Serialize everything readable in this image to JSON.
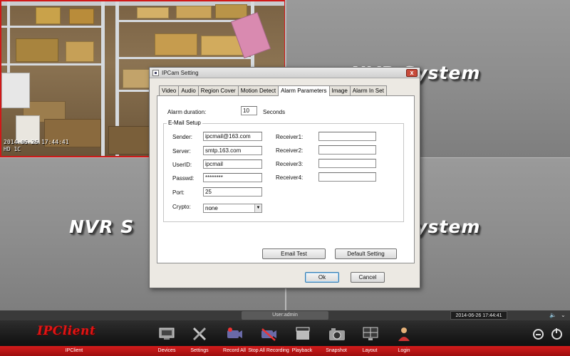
{
  "video": {
    "cam1_timestamp": "2014-06-26 17:44:41",
    "cam1_channel": "HD 1C",
    "watermark": "NVR System",
    "watermark_partial": "NVR S"
  },
  "dialog": {
    "title": "IPCam Setting",
    "close_label": "x",
    "tabs": [
      "Video",
      "Audio",
      "Region Cover",
      "Motion Detect",
      "Alarm Parameters",
      "Image",
      "Alarm In Set"
    ],
    "active_tab": "Alarm Parameters",
    "alarm_duration_label": "Alarm duration:",
    "alarm_duration_value": "10",
    "alarm_duration_unit": "Seconds",
    "email_group_title": "E-Mail Setup",
    "sender_label": "Sender:",
    "sender_value": "ipcmail@163.com",
    "server_label": "Server:",
    "server_value": "smtp.163.com",
    "userid_label": "UserID:",
    "userid_value": "ipcmail",
    "passwd_label": "Passwd:",
    "passwd_value": "********",
    "port_label": "Port:",
    "port_value": "25",
    "crypto_label": "Crypto:",
    "crypto_value": "none",
    "receiver1_label": "Receiver1:",
    "receiver1_value": "",
    "receiver2_label": "Receiver2:",
    "receiver2_value": "",
    "receiver3_label": "Receiver3:",
    "receiver3_value": "",
    "receiver4_label": "Receiver4:",
    "receiver4_value": "",
    "email_test_label": "Email Test",
    "default_setting_label": "Default Setting",
    "ok_label": "Ok",
    "cancel_label": "Cancel"
  },
  "status": {
    "user": "User:admin",
    "clock": "2014-06-26 17:44:41"
  },
  "taskbar": {
    "brand": "IPClient",
    "brand_caption": "IPClient",
    "items": [
      {
        "label": "Devices",
        "icon": "devices-icon"
      },
      {
        "label": "Settings",
        "icon": "settings-icon"
      },
      {
        "label": "Record All",
        "icon": "record-all-icon"
      },
      {
        "label": "Stop All Recording",
        "icon": "stop-recording-icon"
      },
      {
        "label": "Playback",
        "icon": "playback-icon"
      },
      {
        "label": "Snapshot",
        "icon": "snapshot-icon"
      },
      {
        "label": "Layout",
        "icon": "layout-icon"
      },
      {
        "label": "Login",
        "icon": "login-icon"
      }
    ]
  },
  "colors": {
    "accent_red": "#d01818",
    "taskbar": "#141414",
    "dialog_bg": "#ece9e3"
  }
}
